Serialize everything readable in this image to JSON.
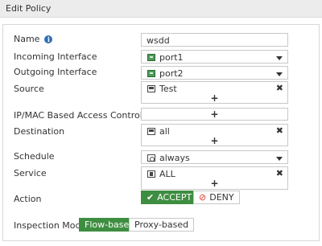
{
  "window": {
    "title": "Edit Policy"
  },
  "form": {
    "name": {
      "label": "Name",
      "value": "wsdd"
    },
    "incoming_interface": {
      "label": "Incoming Interface",
      "value": "port1"
    },
    "outgoing_interface": {
      "label": "Outgoing Interface",
      "value": "port2"
    },
    "source": {
      "label": "Source",
      "entries": [
        "Test"
      ],
      "add": "+"
    },
    "ip_mac": {
      "label": "IP/MAC Based Access Control",
      "add": "+"
    },
    "destination": {
      "label": "Destination",
      "entries": [
        "all"
      ],
      "add": "+"
    },
    "schedule": {
      "label": "Schedule",
      "value": "always"
    },
    "service": {
      "label": "Service",
      "entries": [
        "ALL"
      ],
      "add": "+"
    },
    "action": {
      "label": "Action",
      "options": [
        "ACCEPT",
        "DENY"
      ],
      "selected": "ACCEPT"
    },
    "inspection_mode": {
      "label": "Inspection Mode",
      "options": [
        "Flow-based",
        "Proxy-based"
      ],
      "selected": "Flow-based"
    }
  },
  "icons": {
    "info": "info-icon",
    "remove": "close-icon",
    "check": "check-icon",
    "deny": "deny-icon"
  },
  "colors": {
    "accent_green": "#3e8e41",
    "info_blue": "#2f6fb3",
    "deny_red": "#d9372a"
  }
}
